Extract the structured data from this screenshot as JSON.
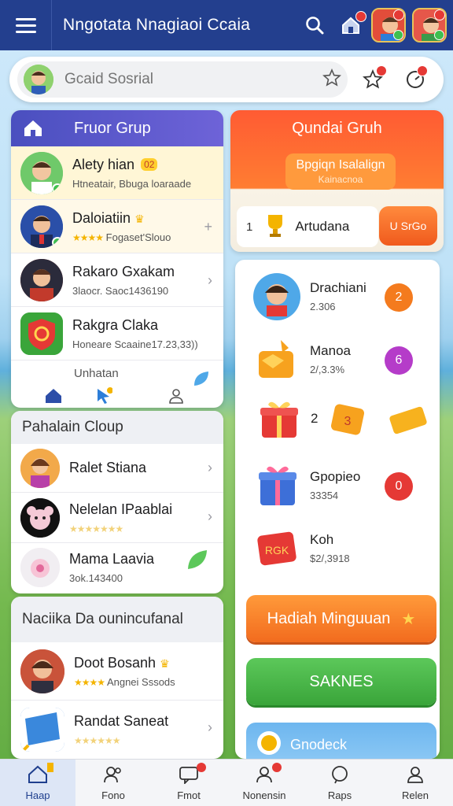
{
  "header": {
    "title": "Nngotata Nnagiaoi Ccaia",
    "menu_icon": "hamburger-icon",
    "search_icon": "search-icon",
    "home_icon": "house-icon"
  },
  "search": {
    "placeholder": "Gcaid Sosrial"
  },
  "left": {
    "my_group_title": "Fruor Grup",
    "group_rows": [
      {
        "name": "Alety hian",
        "sub": "Htneatair, Bbuga loaraade",
        "tag": "02"
      },
      {
        "name": "Daloiatiin",
        "sub": "Fogaset'Slouo"
      },
      {
        "name": "Rakaro Gxakam",
        "sub": "3laocr. Saoc1436190"
      },
      {
        "name": "Rakgra Claka",
        "sub": "Honeare Scaaine17.23,33))"
      }
    ],
    "tab_caption": "Unhatan",
    "popular_title": "Pahalain Cloup",
    "popular_rows": [
      {
        "name": "Ralet Stiana"
      },
      {
        "name": "Nelelan IPaablai"
      },
      {
        "name": "Mama Laavia",
        "sub": "3ok.143400"
      }
    ],
    "recommend_title": "Naciika Da ounincufanal",
    "recommend_rows": [
      {
        "name": "Doot Bosanh",
        "sub": "Angnei Sssods"
      },
      {
        "name": "Randat Saneat"
      }
    ]
  },
  "right": {
    "title": "Qundai Gruh",
    "promo_line1": "Bpgiqn Isalalign",
    "promo_line2": "Kainacnoa",
    "join_number": "1",
    "join_label": "Artudana",
    "join_button": "U SrGo",
    "rewards": [
      {
        "name": "Drachiani",
        "value": "2.306",
        "badge": "2"
      },
      {
        "name": "Manoa",
        "value": "2/,3.3%",
        "badge": "6"
      },
      {
        "name": "",
        "value": "",
        "badge": "2"
      },
      {
        "name": "Gpopieo",
        "value": "33354",
        "badge": "0"
      },
      {
        "name": "Koh",
        "value": "$2/,3918",
        "badge": ""
      }
    ],
    "weekly_button": "Hadiah Minguuan",
    "secondary_button": "SAKNES",
    "bottom_card": "Gnodeck"
  },
  "bottom_nav": [
    {
      "label": "Haap"
    },
    {
      "label": "Fono"
    },
    {
      "label": "Fmot"
    },
    {
      "label": "Nonensin"
    },
    {
      "label": "Raps"
    },
    {
      "label": "Relen"
    }
  ],
  "colors": {
    "header": "#233f8e",
    "accent_orange": "#f26b1e",
    "accent_green": "#3aa53a",
    "panel_purple": "#5a57cc"
  }
}
